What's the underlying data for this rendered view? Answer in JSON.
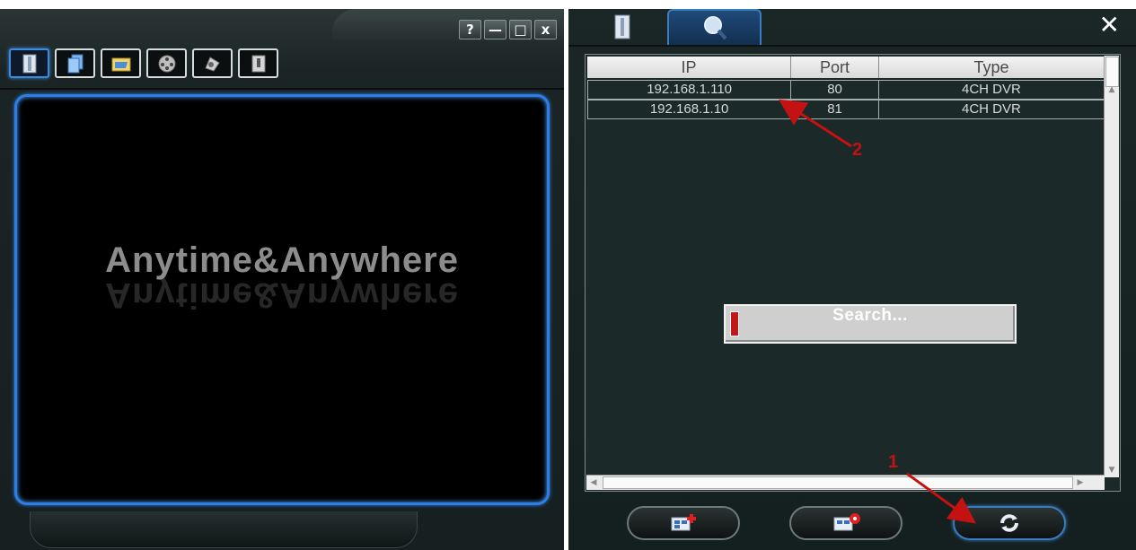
{
  "left_window": {
    "title_buttons": [
      {
        "label": "?",
        "icon": "help-icon"
      },
      {
        "label": "—",
        "icon": "minimize-icon"
      },
      {
        "label": "□",
        "icon": "maximize-icon"
      },
      {
        "label": "x",
        "icon": "close-icon"
      }
    ],
    "toolbar_icons": [
      "address-book-icon",
      "record-list-icon",
      "folder-icon",
      "film-reel-icon",
      "camera-icon",
      "info-icon"
    ],
    "logo_text": "Anytime&Anywhere"
  },
  "right_window": {
    "tabs": [
      {
        "icon": "address-book-icon"
      },
      {
        "icon": "search-icon"
      }
    ],
    "close_label": "✕",
    "table": {
      "columns": [
        "IP",
        "Port",
        "Type"
      ],
      "rows": [
        {
          "ip": "192.168.1.110",
          "port": "80",
          "type": "4CH DVR"
        },
        {
          "ip": "192.168.1.10",
          "port": "81",
          "type": "4CH DVR"
        }
      ]
    },
    "search_status": "Search...",
    "buttons": [
      {
        "icon": "add-device-icon"
      },
      {
        "icon": "device-settings-icon"
      },
      {
        "icon": "refresh-icon"
      }
    ]
  },
  "annotations": {
    "label_1": "1",
    "label_2": "2"
  },
  "colors": {
    "accent_blue": "#2d7fe6",
    "annotation_red": "#c41212"
  }
}
